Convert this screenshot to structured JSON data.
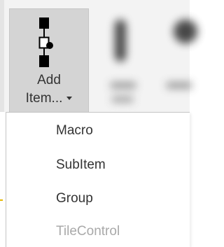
{
  "ribbon": {
    "add_item": {
      "label_line1": "Add",
      "label_line2": "Item...",
      "icon": "add-item-icon"
    }
  },
  "dropdown_menu": {
    "items": [
      {
        "label": "Macro",
        "enabled": true
      },
      {
        "label": "SubItem",
        "enabled": true
      },
      {
        "label": "Group",
        "enabled": true
      },
      {
        "label": "TileControl",
        "enabled": false
      }
    ]
  },
  "colors": {
    "ribbon_bg": "#f3f3f3",
    "button_pressed_bg": "#d4d4d4",
    "menu_bg": "#ffffff",
    "text": "#333333",
    "disabled_text": "#a9a9a9",
    "icon_fill": "#000000"
  }
}
